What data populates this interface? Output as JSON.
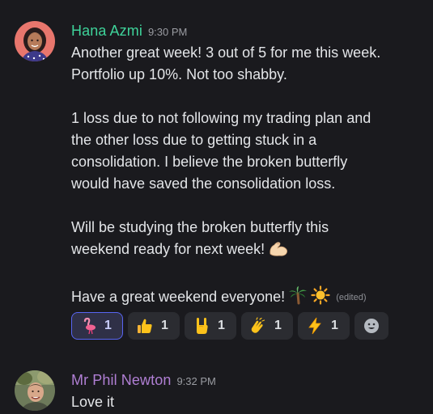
{
  "messages": [
    {
      "author": "Hana Azmi",
      "timestamp": "9:30 PM",
      "author_color": "#3ed39a",
      "paragraphs": {
        "p1_line1": "Another great week! 3 out of 5 for me this week.",
        "p1_line2": "Portfolio up 10%. Not too shabby.",
        "p2_line1": "1 loss due to not following my trading plan and",
        "p2_line2": "the other loss due to getting stuck in a",
        "p2_line3": "consolidation. I believe the broken butterfly",
        "p2_line4": "would have saved the consolidation loss.",
        "p3_line1": "Will be studying the broken butterfly this",
        "p3_line2": "weekend ready for next week!",
        "p4_line1": "Have a great weekend everyone!"
      },
      "inline_emojis": [
        "flexed-biceps-icon",
        "palm-tree-icon",
        "sun-icon"
      ],
      "edited_label": "(edited)",
      "reactions": [
        {
          "icon": "flamingo-icon",
          "count": "1",
          "active": true
        },
        {
          "icon": "thumbs-up-icon",
          "count": "1",
          "active": false
        },
        {
          "icon": "rock-on-hand-icon",
          "count": "1",
          "active": false
        },
        {
          "icon": "clapping-hands-icon",
          "count": "1",
          "active": false
        },
        {
          "icon": "lightning-bolt-icon",
          "count": "1",
          "active": false
        }
      ],
      "add_reaction_icon": "add-reaction-smiley-icon"
    },
    {
      "author": "Mr Phil Newton",
      "timestamp": "9:32 PM",
      "author_color": "#b07fd4",
      "text": "Love it"
    }
  ],
  "colors": {
    "background": "#1a1a1e",
    "reaction_bg": "#2b2c31",
    "reaction_active_border": "#5865f2",
    "text": "#e3e5e8",
    "timestamp": "#9a9ca2"
  }
}
